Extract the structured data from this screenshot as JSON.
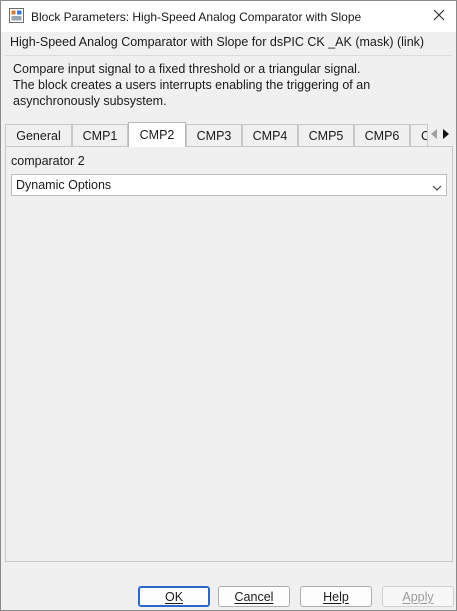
{
  "window": {
    "title": "Block Parameters: High-Speed Analog Comparator with Slope"
  },
  "header": {
    "mask_title": "High-Speed Analog Comparator with Slope for dsPIC CK _AK (mask) (link)",
    "description_lines": [
      "Compare input signal to a fixed threshold or a triangular signal.",
      "The block creates a users interrupts enabling the triggering of an",
      "asynchronously subsystem."
    ]
  },
  "tabs": [
    {
      "label": "General",
      "active": false
    },
    {
      "label": "CMP1",
      "active": false
    },
    {
      "label": "CMP2",
      "active": true
    },
    {
      "label": "CMP3",
      "active": false
    },
    {
      "label": "CMP4",
      "active": false
    },
    {
      "label": "CMP5",
      "active": false
    },
    {
      "label": "CMP6",
      "active": false
    },
    {
      "label": "C",
      "active": false
    }
  ],
  "panel": {
    "group_label": "comparator 2",
    "dropdown_value": "Dynamic Options"
  },
  "buttons": {
    "ok": "OK",
    "cancel": "Cancel",
    "help": "Help",
    "apply": "Apply"
  },
  "icons": {
    "app": "block-parameters-icon",
    "close": "close-icon",
    "tab_left": "triangle-left-icon",
    "tab_right": "triangle-right-icon",
    "dropdown": "chevron-down-icon"
  },
  "colors": {
    "window_bg": "#f0f0f0",
    "titlebar_bg": "#ffffff",
    "default_button_border": "#2b67c6"
  }
}
